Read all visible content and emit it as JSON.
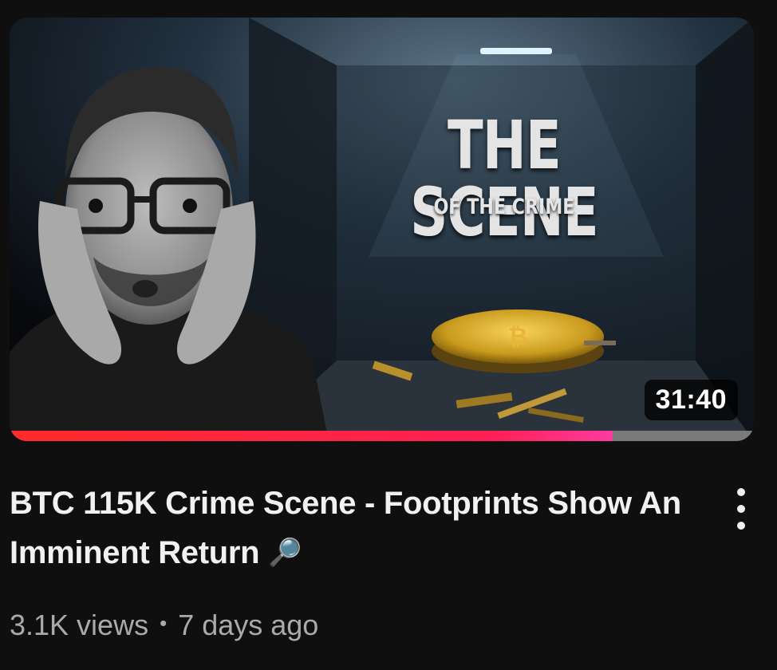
{
  "video": {
    "thumbnail": {
      "headline": "THE SCENE",
      "subheadline": "OF THE CRIME",
      "duration": "31:40",
      "watch_progress": 0.81,
      "progress_color": "#ff2a2a"
    },
    "title": "BTC 115K Crime Scene - Footprints Show An Imminent Return",
    "title_emoji": "🔎",
    "views": "3.1K views",
    "separator": "•",
    "uploaded": "7 days ago",
    "menu_icon": "more-vertical-icon"
  }
}
